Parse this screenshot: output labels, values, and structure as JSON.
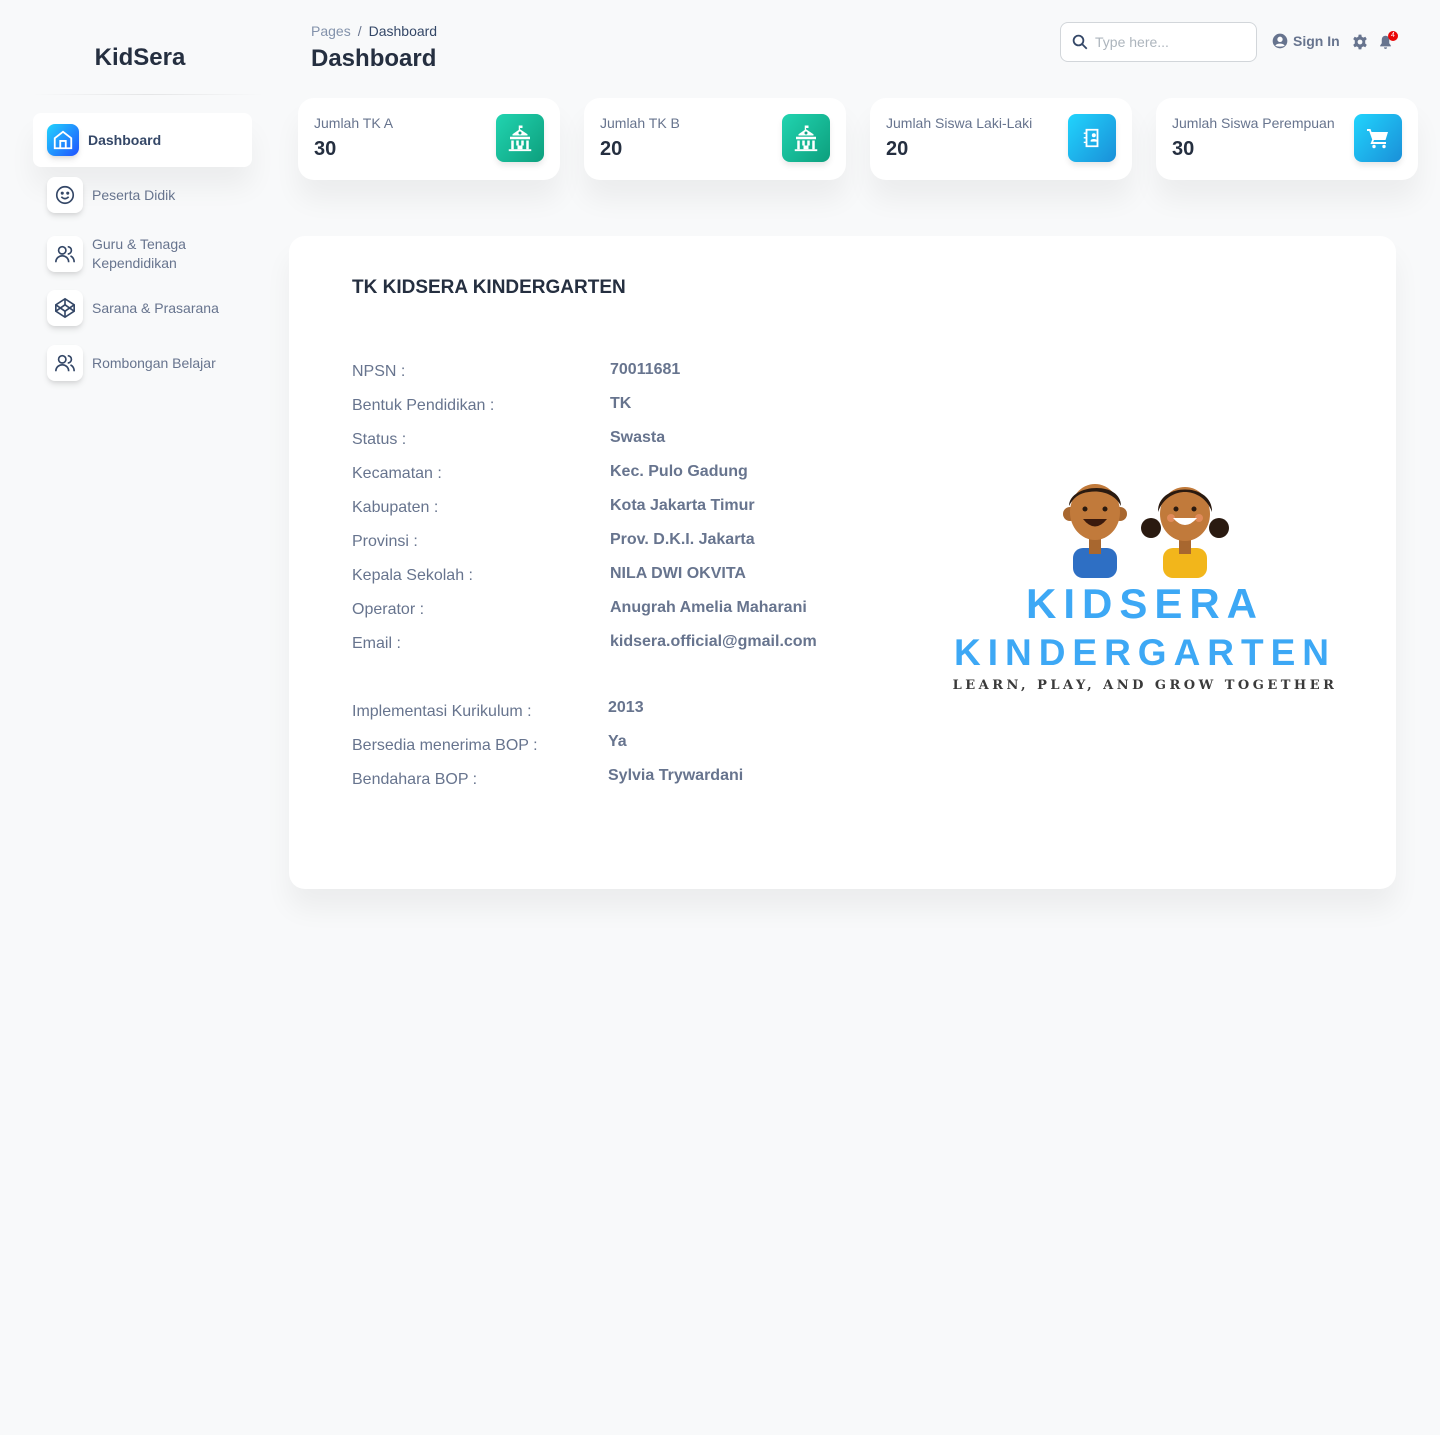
{
  "brand": "KidSera",
  "sidebar": {
    "items": [
      {
        "label": "Dashboard",
        "icon": "home-icon",
        "active": true
      },
      {
        "label": "Peserta Didik",
        "icon": "smile-icon"
      },
      {
        "label": "Guru & Tenaga Kependidikan",
        "icon": "users-icon"
      },
      {
        "label": "Sarana & Prasarana",
        "icon": "codepen-icon"
      },
      {
        "label": "Rombongan Belajar",
        "icon": "users-icon"
      }
    ]
  },
  "header": {
    "breadcrumb_root": "Pages",
    "breadcrumb_sep": "/",
    "breadcrumb_current": "Dashboard",
    "title": "Dashboard",
    "search_placeholder": "Type here...",
    "signin_label": "Sign In",
    "notification_count": "4"
  },
  "stats": [
    {
      "label": "Jumlah TK A",
      "value": "30",
      "icon": "school-icon",
      "color": "#0d9f7d"
    },
    {
      "label": "Jumlah TK B",
      "value": "20",
      "icon": "school-icon",
      "color": "#0d9f7d"
    },
    {
      "label": "Jumlah Siswa Laki-Laki",
      "value": "20",
      "icon": "contact-icon",
      "color": "#1a8fd8"
    },
    {
      "label": "Jumlah Siswa Perempuan",
      "value": "30",
      "icon": "cart-icon",
      "color": "#1a8fd8"
    }
  ],
  "info": {
    "title": "TK KIDSERA KINDERGARTEN",
    "rows": [
      {
        "label": "NPSN :",
        "value": "70011681"
      },
      {
        "label": "Bentuk Pendidikan :",
        "value": "TK"
      },
      {
        "label": "Status :",
        "value": "Swasta"
      },
      {
        "label": "Kecamatan :",
        "value": "Kec. Pulo Gadung"
      },
      {
        "label": "Kabupaten :",
        "value": "Kota Jakarta Timur"
      },
      {
        "label": "Provinsi :",
        "value": "Prov. D.K.I. Jakarta"
      },
      {
        "label": "Kepala Sekolah :",
        "value": "NILA DWI OKVITA"
      },
      {
        "label": "Operator :",
        "value": "Anugrah Amelia Maharani"
      },
      {
        "label": "Email :",
        "value": "kidsera.official@gmail.com"
      },
      {
        "label": "Implementasi Kurikulum :",
        "value": "2013"
      },
      {
        "label": "Bersedia menerima BOP :",
        "value": "Ya"
      },
      {
        "label": "Bendahara BOP :",
        "value": "Sylvia Trywardani"
      }
    ]
  },
  "logo": {
    "line1": "KIDSERA",
    "line2": "KINDERGARTEN",
    "tagline": "LEARN, PLAY, AND GROW TOGETHER",
    "color": "#3da8f5"
  }
}
